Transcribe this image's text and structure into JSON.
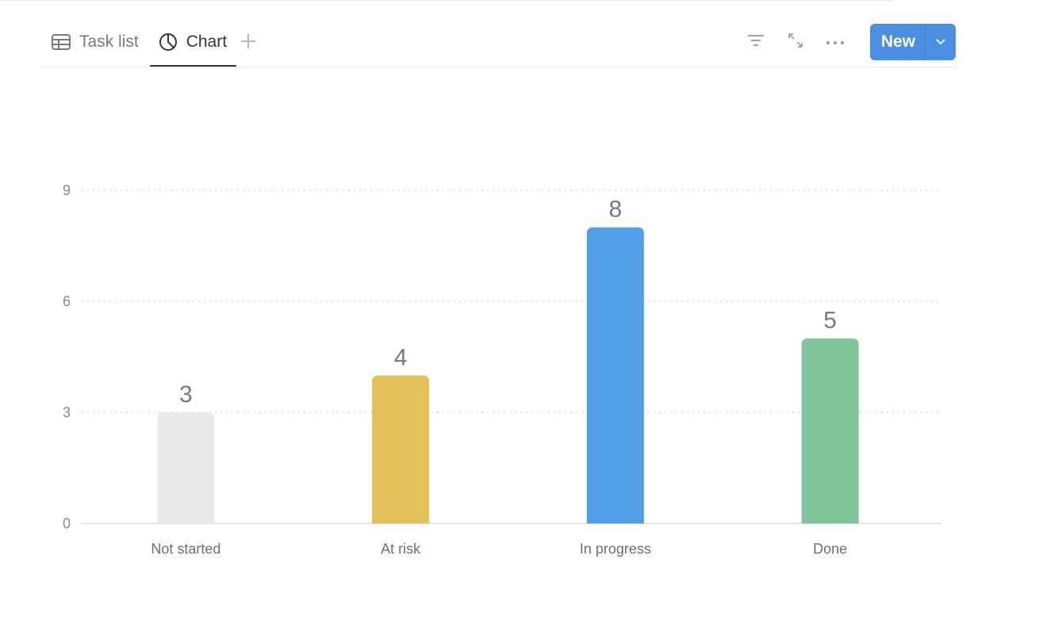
{
  "tabs": [
    {
      "label": "Task list",
      "icon": "table-icon",
      "active": false
    },
    {
      "label": "Chart",
      "icon": "pie-chart-icon",
      "active": true
    }
  ],
  "toolbar": {
    "add_view_icon": "plus-icon",
    "filter_icon": "filter-icon",
    "expand_icon": "expand-icon",
    "more_icon": "more-icon",
    "new_label": "New",
    "new_dropdown_icon": "chevron-down-icon",
    "accent": "#4a8fe0"
  },
  "chart_data": {
    "type": "bar",
    "title": "",
    "xlabel": "",
    "ylabel": "",
    "categories": [
      "Not started",
      "At risk",
      "In progress",
      "Done"
    ],
    "values": [
      3,
      4,
      8,
      5
    ],
    "colors": [
      "#e8e8e8",
      "#e3c059",
      "#529fe8",
      "#82c49a"
    ],
    "ylim": [
      0,
      9
    ],
    "yticks": [
      0,
      3,
      6,
      9
    ],
    "grid": true,
    "data_labels": true,
    "legend": "none"
  }
}
